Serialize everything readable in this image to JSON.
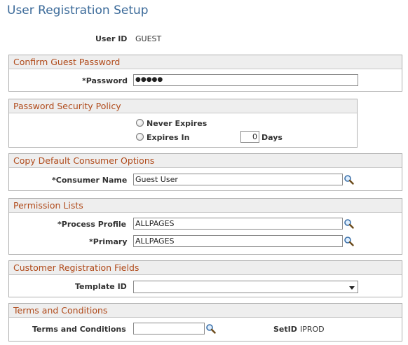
{
  "page": {
    "title": "User Registration Setup"
  },
  "user": {
    "label": "User ID",
    "value": "GUEST"
  },
  "confirm_password": {
    "header": "Confirm Guest Password",
    "password_label": "*Password",
    "password_value": "●●●●●"
  },
  "security_policy": {
    "header": "Password Security Policy",
    "never_expires_label": "Never Expires",
    "expires_in_label": "Expires In",
    "days_value": "0",
    "days_label": "Days"
  },
  "consumer_options": {
    "header": "Copy Default Consumer Options",
    "consumer_name_label": "*Consumer Name",
    "consumer_name_value": "Guest User"
  },
  "permission_lists": {
    "header": "Permission Lists",
    "process_profile_label": "*Process Profile",
    "process_profile_value": "ALLPAGES",
    "primary_label": "*Primary",
    "primary_value": "ALLPAGES"
  },
  "registration_fields": {
    "header": "Customer Registration Fields",
    "template_id_label": "Template ID",
    "template_id_value": ""
  },
  "terms": {
    "header": "Terms and Conditions",
    "terms_label": "Terms and Conditions",
    "terms_value": "",
    "setid_label": "SetID",
    "setid_value": "IPROD"
  },
  "icons": {
    "lookup": "magnifier-lookup-icon",
    "dropdown": "chevron-down-icon"
  },
  "colors": {
    "title": "#3b6a99",
    "section_header": "#b04a1a",
    "header_bg": "#eeeeee"
  }
}
